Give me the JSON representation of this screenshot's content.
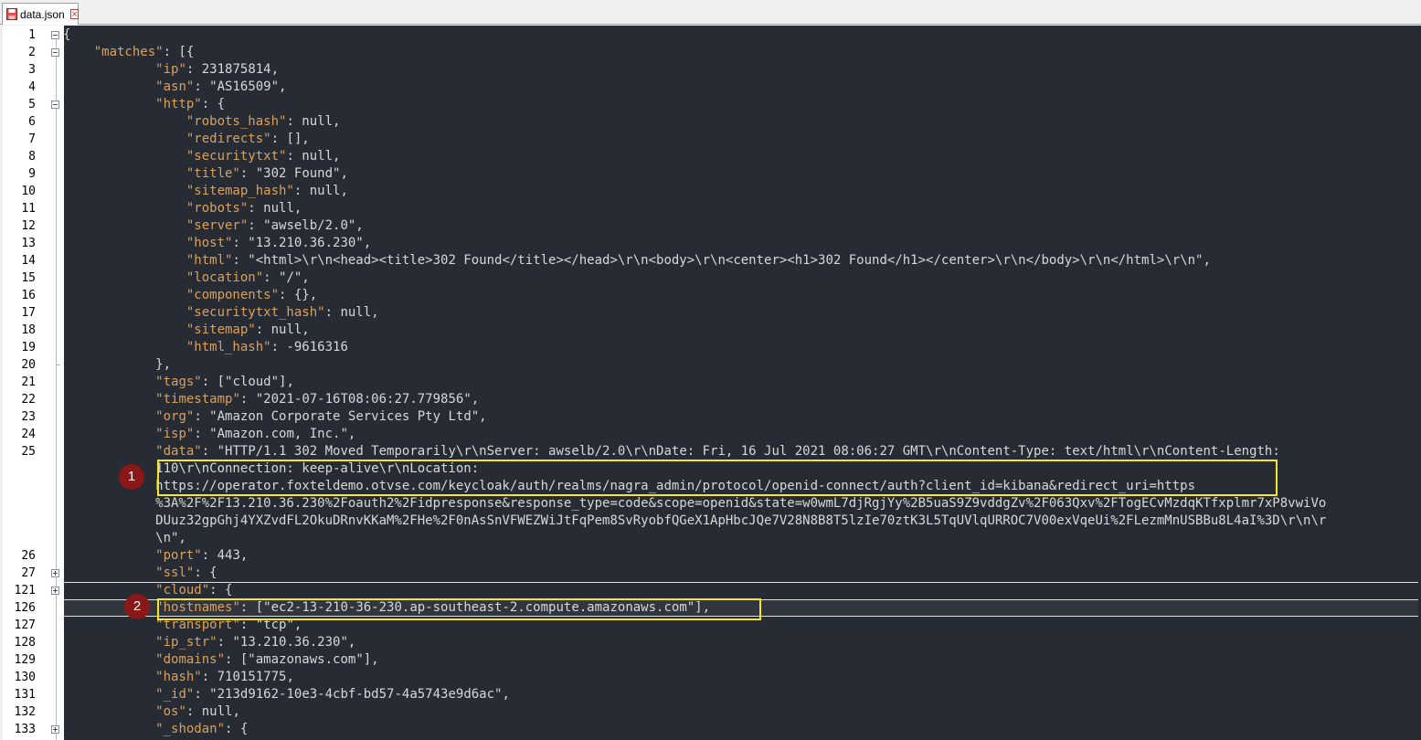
{
  "tab": {
    "filename": "data.json",
    "file_icon": "save-disk-icon",
    "close_icon": "close-x-icon",
    "close_label": "×"
  },
  "lines": [
    {
      "n": "1",
      "text": "{"
    },
    {
      "n": "2",
      "text": "    \"matches\": [{"
    },
    {
      "n": "3",
      "text": "            \"ip\": 231875814,"
    },
    {
      "n": "4",
      "text": "            \"asn\": \"AS16509\","
    },
    {
      "n": "5",
      "text": "            \"http\": {"
    },
    {
      "n": "6",
      "text": "                \"robots_hash\": null,"
    },
    {
      "n": "7",
      "text": "                \"redirects\": [],"
    },
    {
      "n": "8",
      "text": "                \"securitytxt\": null,"
    },
    {
      "n": "9",
      "text": "                \"title\": \"302 Found\","
    },
    {
      "n": "10",
      "text": "                \"sitemap_hash\": null,"
    },
    {
      "n": "11",
      "text": "                \"robots\": null,"
    },
    {
      "n": "12",
      "text": "                \"server\": \"awselb/2.0\","
    },
    {
      "n": "13",
      "text": "                \"host\": \"13.210.36.230\","
    },
    {
      "n": "14",
      "text": "                \"html\": \"<html>\\r\\n<head><title>302 Found</title></head>\\r\\n<body>\\r\\n<center><h1>302 Found</h1></center>\\r\\n</body>\\r\\n</html>\\r\\n\","
    },
    {
      "n": "15",
      "text": "                \"location\": \"/\","
    },
    {
      "n": "16",
      "text": "                \"components\": {},"
    },
    {
      "n": "17",
      "text": "                \"securitytxt_hash\": null,"
    },
    {
      "n": "18",
      "text": "                \"sitemap\": null,"
    },
    {
      "n": "19",
      "text": "                \"html_hash\": -9616316"
    },
    {
      "n": "20",
      "text": "            },"
    },
    {
      "n": "21",
      "text": "            \"tags\": [\"cloud\"],"
    },
    {
      "n": "22",
      "text": "            \"timestamp\": \"2021-07-16T08:06:27.779856\","
    },
    {
      "n": "23",
      "text": "            \"org\": \"Amazon Corporate Services Pty Ltd\","
    },
    {
      "n": "24",
      "text": "            \"isp\": \"Amazon.com, Inc.\","
    },
    {
      "n": "25",
      "text": "            \"data\": \"HTTP/1.1 302 Moved Temporarily\\r\\nServer: awselb/2.0\\r\\nDate: Fri, 16 Jul 2021 08:06:27 GMT\\r\\nContent-Type: text/html\\r\\nContent-Length:"
    },
    {
      "n": "",
      "text": "            110\\r\\nConnection: keep-alive\\r\\nLocation:"
    },
    {
      "n": "",
      "text": "            https://operator.foxteldemo.otvse.com/keycloak/auth/realms/nagra_admin/protocol/openid-connect/auth?client_id=kibana&redirect_uri=https"
    },
    {
      "n": "",
      "text": "            %3A%2F%2F13.210.36.230%2Foauth2%2Fidpresponse&response_type=code&scope=openid&state=w0wmL7djRgjYy%2B5uaS9Z9vddgZv%2F063Qxv%2FTogECvMzdqKTfxplmr7xP8vwiVo"
    },
    {
      "n": "",
      "text": "            DUuz32gpGhj4YXZvdFL2OkuDRnvKKaM%2FHe%2F0nAsSnVFWEZWiJtFqPem8SvRyobfQGeX1ApHbcJQe7V28N8B8T5lzIe70ztK3L5TqUVlqURROC7V00exVqeUi%2FLezmMnUSBBu8L4aI%3D\\r\\n\\r"
    },
    {
      "n": "",
      "text": "            \\n\","
    },
    {
      "n": "26",
      "text": "            \"port\": 443,"
    },
    {
      "n": "27",
      "text": "            \"ssl\": {"
    },
    {
      "n": "121",
      "text": "            \"cloud\": {"
    },
    {
      "n": "126",
      "text": "            \"hostnames\": [\"ec2-13-210-36-230.ap-southeast-2.compute.amazonaws.com\"],"
    },
    {
      "n": "127",
      "text": "            \"transport\": \"tcp\","
    },
    {
      "n": "128",
      "text": "            \"ip_str\": \"13.210.36.230\","
    },
    {
      "n": "129",
      "text": "            \"domains\": [\"amazonaws.com\"],"
    },
    {
      "n": "130",
      "text": "            \"hash\": 710151775,"
    },
    {
      "n": "131",
      "text": "            \"_id\": \"213d9162-10e3-4cbf-bd57-4a5743e9d6ac\","
    },
    {
      "n": "132",
      "text": "            \"os\": null,"
    },
    {
      "n": "133",
      "text": "            \"_shodan\": {"
    }
  ],
  "annotations": [
    {
      "label": "1"
    },
    {
      "label": "2"
    }
  ],
  "colors": {
    "editor_bg": "#272b33",
    "key": "#d9a15d",
    "text": "#e8e8e8",
    "highlight": "#f5e62a",
    "badge": "#8b1818"
  }
}
